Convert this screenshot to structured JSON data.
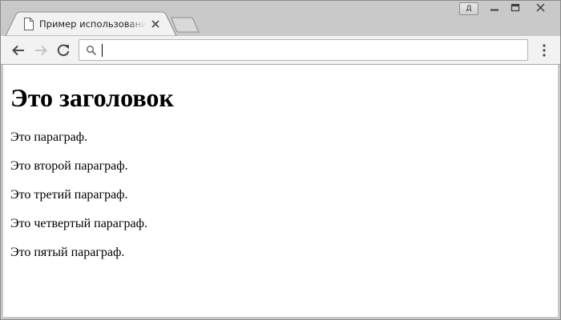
{
  "tab": {
    "title": "Пример использования тега",
    "favicon": "document-icon"
  },
  "window_controls": {
    "profile_label": "Д"
  },
  "address_bar": {
    "value": "",
    "icon": "search-icon"
  },
  "page": {
    "heading": "Это заголовок",
    "paragraphs": [
      "Это параграф.",
      "Это второй параграф.",
      "Это третий параграф.",
      "Это четвертый параграф.",
      "Это пятый параграф."
    ]
  },
  "colors": {
    "frame": "#c9c9c9",
    "toolbar": "#f2f2f2",
    "active_tab": "#f2f2f2",
    "page_background": "#ffffff"
  }
}
